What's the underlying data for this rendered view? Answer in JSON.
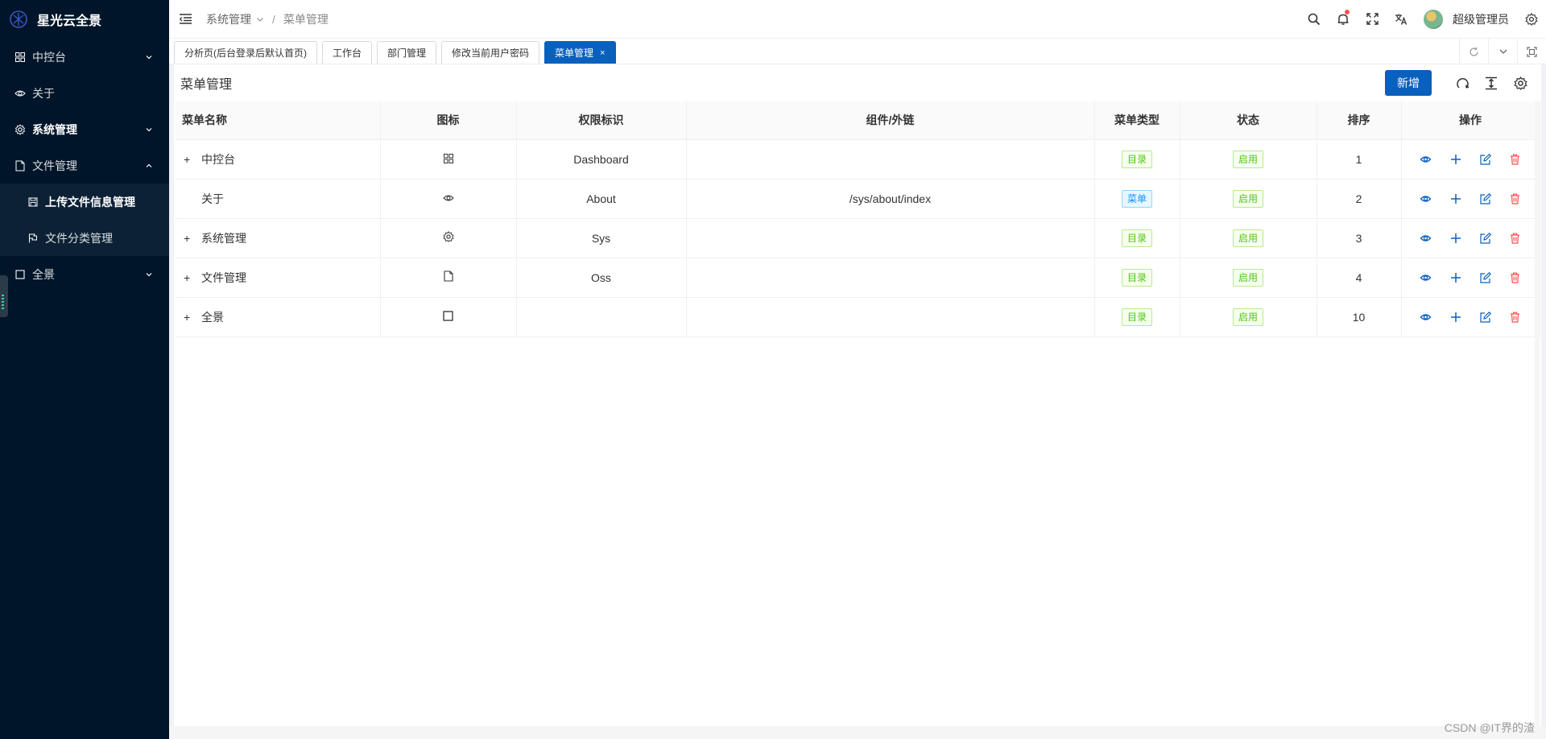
{
  "app": {
    "title": "星光云全景"
  },
  "sidebar": {
    "items": [
      {
        "label": "中控台",
        "icon": "dashboard-grid-icon",
        "arrow": "down"
      },
      {
        "label": "关于",
        "icon": "eye-icon",
        "arrow": ""
      },
      {
        "label": "系统管理",
        "icon": "gear-icon",
        "arrow": "down",
        "bold": true
      },
      {
        "label": "文件管理",
        "icon": "file-icon",
        "arrow": "up"
      },
      {
        "label": "全景",
        "icon": "square-icon",
        "arrow": "down"
      }
    ],
    "sub_items": [
      {
        "label": "上传文件信息管理",
        "icon": "save-icon"
      },
      {
        "label": "文件分类管理",
        "icon": "flag-icon"
      }
    ]
  },
  "header": {
    "breadcrumb_parent": "系统管理",
    "breadcrumb_sep": "/",
    "breadcrumb_current": "菜单管理",
    "username": "超级管理员"
  },
  "tabs": [
    {
      "label": "分析页(后台登录后默认首页)"
    },
    {
      "label": "工作台"
    },
    {
      "label": "部门管理"
    },
    {
      "label": "修改当前用户密码"
    },
    {
      "label": "菜单管理",
      "close": "×"
    }
  ],
  "panel": {
    "title": "菜单管理",
    "add_button": "新增"
  },
  "table": {
    "columns": [
      "菜单名称",
      "图标",
      "权限标识",
      "组件/外链",
      "菜单类型",
      "状态",
      "排序",
      "操作"
    ],
    "rows": [
      {
        "expand": "+",
        "name": "中控台",
        "icon": "dashboard-grid-icon",
        "perm": "Dashboard",
        "component": "",
        "type": "目录",
        "type_color": "green",
        "status": "启用",
        "order": "1"
      },
      {
        "expand": "",
        "name": "关于",
        "icon": "eye-icon",
        "perm": "About",
        "component": "/sys/about/index",
        "type": "菜单",
        "type_color": "blue",
        "status": "启用",
        "order": "2"
      },
      {
        "expand": "+",
        "name": "系统管理",
        "icon": "gear-icon",
        "perm": "Sys",
        "component": "",
        "type": "目录",
        "type_color": "green",
        "status": "启用",
        "order": "3"
      },
      {
        "expand": "+",
        "name": "文件管理",
        "icon": "file-icon",
        "perm": "Oss",
        "component": "",
        "type": "目录",
        "type_color": "green",
        "status": "启用",
        "order": "4"
      },
      {
        "expand": "+",
        "name": "全景",
        "icon": "square-icon",
        "perm": "",
        "component": "",
        "type": "目录",
        "type_color": "green",
        "status": "启用",
        "order": "10"
      }
    ]
  },
  "watermark": "CSDN @IT界的渣",
  "colors": {
    "sidebar_bg": "#001529",
    "primary": "#0960bd",
    "tag_green": "#52c41a",
    "tag_blue": "#1890ff",
    "delete_red": "#ff4d4f"
  }
}
